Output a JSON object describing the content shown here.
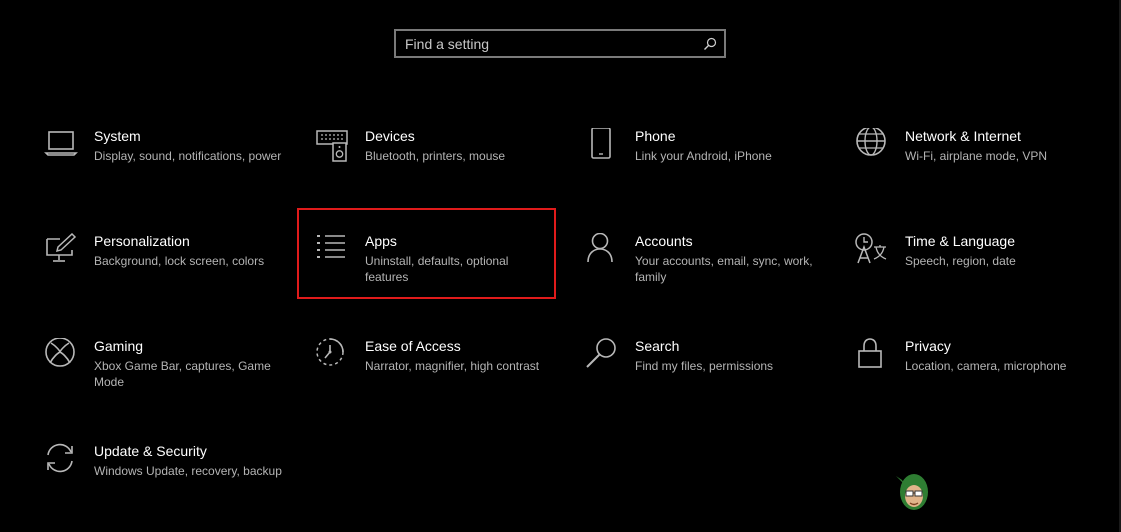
{
  "search": {
    "placeholder": "Find a setting",
    "icon": "search-icon"
  },
  "tiles": [
    {
      "title": "System",
      "desc": "Display, sound, notifications, power",
      "icon": "laptop-icon"
    },
    {
      "title": "Devices",
      "desc": "Bluetooth, printers, mouse",
      "icon": "keyboard-speaker-icon"
    },
    {
      "title": "Phone",
      "desc": "Link your Android, iPhone",
      "icon": "phone-icon"
    },
    {
      "title": "Network & Internet",
      "desc": "Wi-Fi, airplane mode, VPN",
      "icon": "globe-icon"
    },
    {
      "title": "Personalization",
      "desc": "Background, lock screen, colors",
      "icon": "paint-brush-icon"
    },
    {
      "title": "Apps",
      "desc": "Uninstall, defaults, optional features",
      "icon": "apps-list-icon"
    },
    {
      "title": "Accounts",
      "desc": "Your accounts, email, sync, work, family",
      "icon": "person-icon"
    },
    {
      "title": "Time & Language",
      "desc": "Speech, region, date",
      "icon": "time-language-icon"
    },
    {
      "title": "Gaming",
      "desc": "Xbox Game Bar, captures, Game Mode",
      "icon": "xbox-icon"
    },
    {
      "title": "Ease of Access",
      "desc": "Narrator, magnifier, high contrast",
      "icon": "ease-of-access-icon"
    },
    {
      "title": "Search",
      "desc": "Find my files, permissions",
      "icon": "magnifier-icon"
    },
    {
      "title": "Privacy",
      "desc": "Location, camera, microphone",
      "icon": "lock-icon"
    },
    {
      "title": "Update & Security",
      "desc": "Windows Update, recovery, backup",
      "icon": "sync-arrows-icon"
    }
  ],
  "colors": {
    "background": "#000000",
    "text": "#ffffff",
    "secondary_text": "#b4b4b4",
    "highlight_border": "#e01b1b",
    "icon_stroke": "#b8b8b8"
  }
}
